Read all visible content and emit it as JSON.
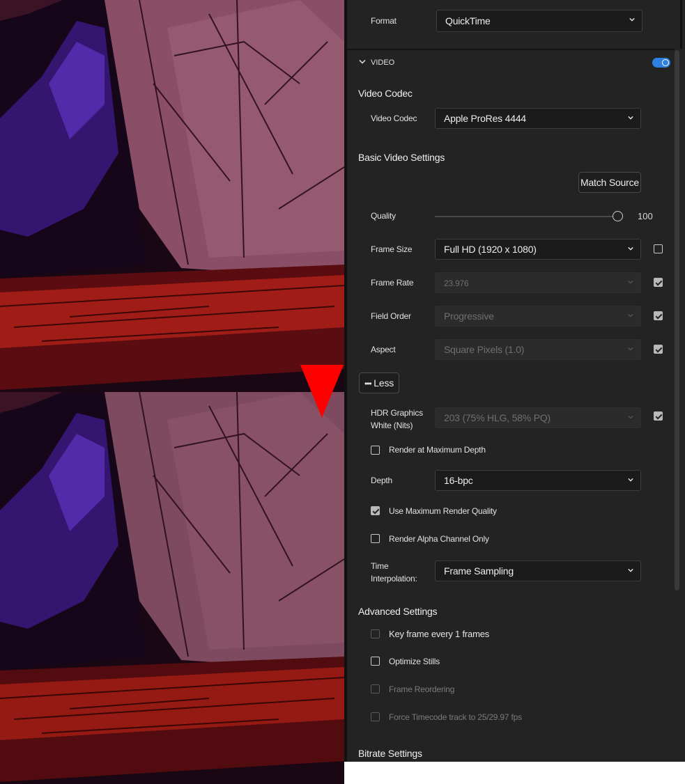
{
  "format": {
    "label": "Format",
    "value": "QuickTime"
  },
  "video_section": {
    "header": "VIDEO",
    "enabled": true
  },
  "video_codec": {
    "section_title": "Video Codec",
    "label": "Video Codec",
    "value": "Apple ProRes 4444"
  },
  "basic": {
    "section_title": "Basic Video Settings",
    "match_source": "Match Source",
    "quality": {
      "label": "Quality",
      "value": "100"
    },
    "frame_size": {
      "label": "Frame Size",
      "value": "Full HD (1920 x 1080)"
    },
    "frame_rate": {
      "label": "Frame Rate",
      "value": "23.976"
    },
    "field_order": {
      "label": "Field Order",
      "value": "Progressive"
    },
    "aspect": {
      "label": "Aspect",
      "value": "Square Pixels (1.0)"
    },
    "less_button": "Less",
    "hdr": {
      "label_line1": "HDR Graphics",
      "label_line2": "White (Nits)",
      "value": "203 (75% HLG, 58% PQ)"
    },
    "render_max_depth": "Render at Maximum Depth",
    "depth": {
      "label": "Depth",
      "value": "16-bpc"
    },
    "use_max_quality": "Use Maximum Render Quality",
    "alpha_only": "Render Alpha Channel Only",
    "time_interp": {
      "label_line1": "Time",
      "label_line2": "Interpolation:",
      "value": "Frame Sampling"
    }
  },
  "advanced": {
    "section_title": "Advanced Settings",
    "keyframe": "Key frame every 1 frames",
    "optimize_stills": "Optimize Stills",
    "frame_reordering": "Frame Reordering",
    "force_timecode": "Force Timecode track to 25/29.97 fps"
  },
  "bitrate": {
    "section_title": "Bitrate Settings"
  },
  "colors": {
    "accent": "#2f7fe0",
    "arrow": "#ff0000"
  }
}
